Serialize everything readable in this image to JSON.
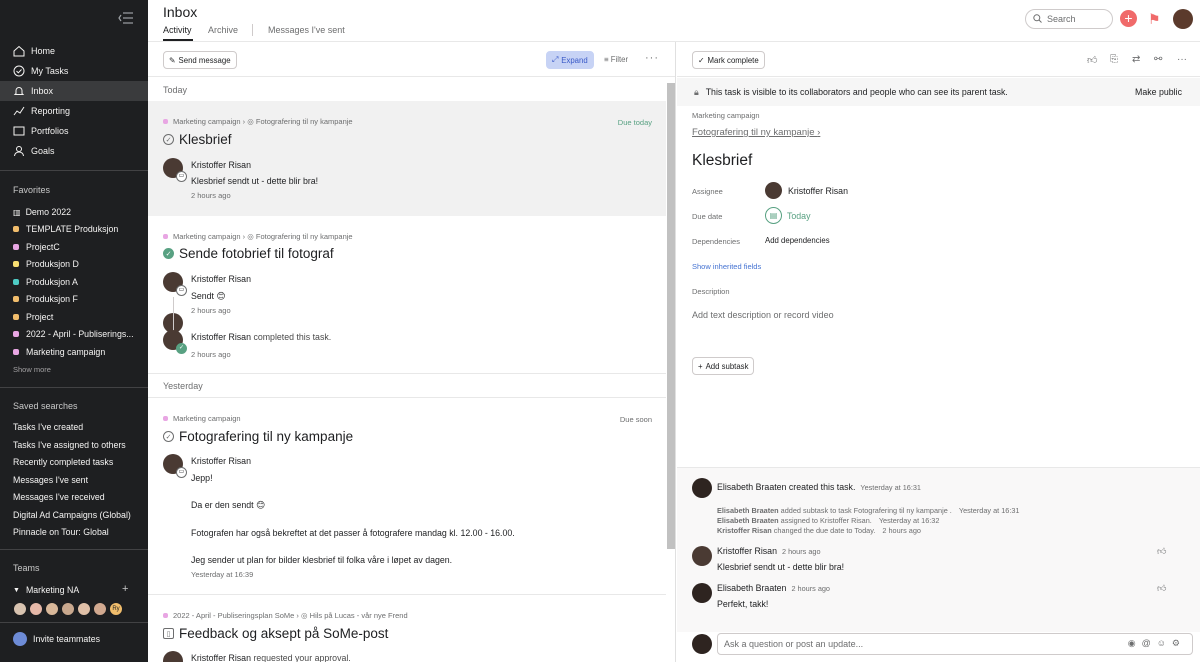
{
  "sidebar": {
    "nav": [
      {
        "label": "Home",
        "icon": "home-icon"
      },
      {
        "label": "My Tasks",
        "icon": "check-circle-icon"
      },
      {
        "label": "Inbox",
        "icon": "bell-icon"
      },
      {
        "label": "Reporting",
        "icon": "chart-icon"
      },
      {
        "label": "Portfolios",
        "icon": "folder-icon"
      },
      {
        "label": "Goals",
        "icon": "person-icon"
      }
    ],
    "favorites_title": "Favorites",
    "favorites": [
      {
        "label": "Demo 2022",
        "color": "#c7c4c4",
        "icon": "bar-chart-icon"
      },
      {
        "label": "TEMPLATE Produksjon",
        "color": "#f1bd6c"
      },
      {
        "label": "ProjectC",
        "color": "#e8a6e3"
      },
      {
        "label": "Produksjon D",
        "color": "#f8df72"
      },
      {
        "label": "Produksjon A",
        "color": "#4ecbc4"
      },
      {
        "label": "Produksjon F",
        "color": "#f1bd6c"
      },
      {
        "label": "Project",
        "color": "#f1bd6c"
      },
      {
        "label": "2022 - April - Publiserings...",
        "color": "#e8a6e3"
      },
      {
        "label": "Marketing campaign",
        "color": "#e8a6e3"
      }
    ],
    "show_more": "Show more",
    "saved_title": "Saved searches",
    "saved": [
      "Tasks I've created",
      "Tasks I've assigned to others",
      "Recently completed tasks",
      "Messages I've sent",
      "Messages I've received",
      "Digital Ad Campaigns (Global)",
      "Pinnacle on Tour: Global"
    ],
    "teams_title": "Teams",
    "team": "Marketing NA",
    "invite": "Invite teammates",
    "avatar_badge": "Ry"
  },
  "header": {
    "title": "Inbox",
    "tabs": [
      "Activity",
      "Archive",
      "Messages I've sent"
    ],
    "search_placeholder": "Search"
  },
  "inbox": {
    "send_message": "Send message",
    "expand": "Expand",
    "filter": "Filter",
    "today": "Today",
    "yesterday": "Yesterday",
    "items": [
      {
        "project": "Marketing campaign",
        "parent": "Fotografering til ny kampanje",
        "title": "Klesbrief",
        "due": "Due today",
        "author": "Kristoffer Risan",
        "text": "Klesbrief sendt ut  - dette blir bra!",
        "time": "2 hours ago"
      },
      {
        "project": "Marketing campaign",
        "parent": "Fotografering til ny kampanje",
        "title": "Sende fotobrief til fotograf",
        "author": "Kristoffer Risan",
        "text": "Sendt 😊",
        "time": "2 hours ago",
        "author2": "Kristoffer Risan",
        "action2": "completed this task.",
        "time2": "2 hours ago"
      },
      {
        "project": "Marketing campaign",
        "title": "Fotografering til ny kampanje",
        "due": "Due soon",
        "author": "Kristoffer Risan",
        "lines": [
          "Jepp!",
          "Da er den sendt 😊",
          "Fotografen har også bekreftet at det passer å fotografere mandag kl. 12.00 - 16.00.",
          "Jeg sender ut plan for bilder klesbrief til folka våre i løpet av dagen."
        ],
        "time": "Yesterday at 16:39"
      },
      {
        "project": "2022 - April - Publiseringsplan SoMe",
        "parent": "Hils på Lucas - vår nye Frend",
        "title": "Feedback og aksept på SoMe-post",
        "author": "Kristoffer Risan",
        "action": "requested your approval."
      }
    ]
  },
  "detail": {
    "mark_complete": "Mark complete",
    "visibility": "This task is visible to its collaborators and people who can see its parent task.",
    "make_public": "Make public",
    "project": "Marketing campaign",
    "parent": "Fotografering til ny kampanje",
    "title": "Klesbrief",
    "assignee_label": "Assignee",
    "assignee": "Kristoffer Risan",
    "due_label": "Due date",
    "due": "Today",
    "dep_label": "Dependencies",
    "dep_value": "Add dependencies",
    "inherited": "Show inherited fields",
    "desc_label": "Description",
    "desc_placeholder": "Add text description or record video",
    "add_subtask": "Add subtask",
    "activity": {
      "creator": "Elisabeth Braaten created this task.",
      "creator_time": "Yesterday at 16:31",
      "log": [
        {
          "who": "Elisabeth Braaten",
          "what": "added subtask to task Fotografering til ny kampanje .",
          "when": "Yesterday at 16:31"
        },
        {
          "who": "Elisabeth Braaten",
          "what": "assigned to Kristoffer Risan.",
          "when": "Yesterday at 16:32"
        },
        {
          "who": "Kristoffer Risan",
          "what": "changed the due date to Today.",
          "when": "2 hours ago"
        }
      ],
      "comments": [
        {
          "who": "Kristoffer Risan",
          "when": "2 hours ago",
          "text": "Klesbrief sendt ut  - dette blir bra!"
        },
        {
          "who": "Elisabeth Braaten",
          "when": "2 hours ago",
          "text": "Perfekt, takk!"
        }
      ]
    },
    "composer_placeholder": "Ask a question or post an update..."
  }
}
